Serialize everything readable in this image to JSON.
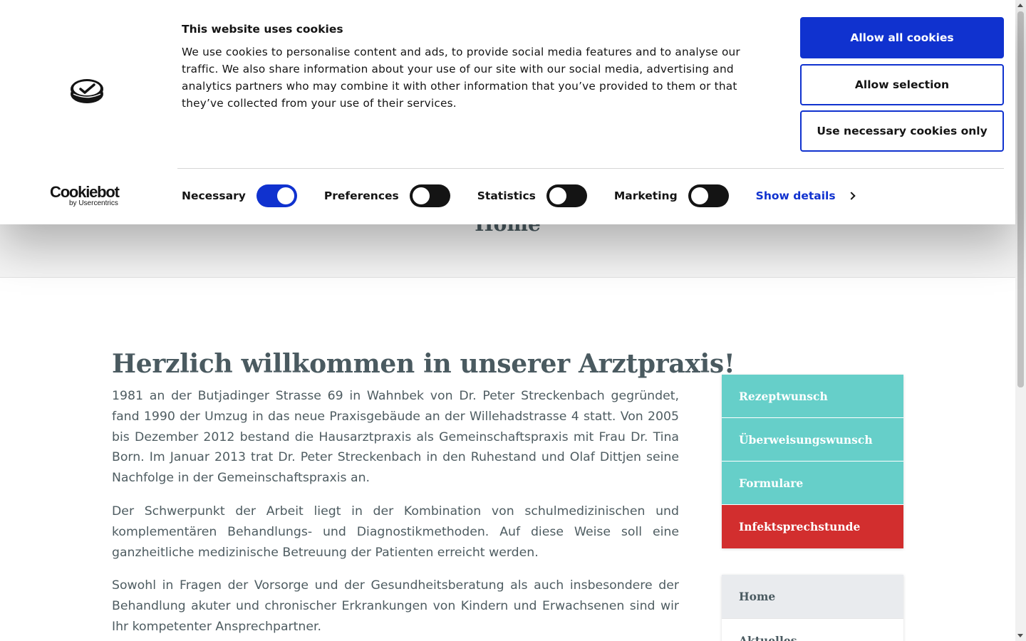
{
  "page": {
    "header_title": "Home",
    "welcome_title": "Herzlich willkommen in unserer Arztpraxis!",
    "paragraphs": [
      "1981 an der Butjadinger Strasse 69 in Wahnbek von Dr. Peter Streckenbach gegründet, fand 1990 der Umzug in das neue Praxisgebäude an der Willehadstrasse 4 statt. Von 2005 bis Dezember 2012 bestand die Hausarztpraxis als Gemeinschaftspraxis mit Frau Dr. Tina Born. Im Januar 2013 trat Dr. Peter Streckenbach in den Ruhestand und Olaf Dittjen seine Nachfolge in der Gemeinschaftspraxis an.",
      "Der Schwerpunkt der Arbeit liegt in der Kombination von schulmedizinischen und komplementären Behandlungs- und Diagnostikmethoden. Auf diese Weise soll eine ganzheitliche medizinische Betreuung der Patienten erreicht werden.",
      "Sowohl in Fragen der Vorsorge und der Gesundheitsberatung als auch insbesondere der Behandlung akuter und chronischer Erkrankungen von Kindern und Erwachsenen sind wir Ihr kompetenter Ansprechpartner."
    ]
  },
  "quick_links": [
    {
      "label": "Rezeptwunsch",
      "color": "#66cfc9"
    },
    {
      "label": "Überweisungswunsch",
      "color": "#66cfc9"
    },
    {
      "label": "Formulare",
      "color": "#66cfc9"
    },
    {
      "label": "Infektsprechstunde",
      "color": "#d22e2e"
    }
  ],
  "side_nav": [
    {
      "label": "Home",
      "active": true
    },
    {
      "label": "Aktuelles",
      "active": false
    }
  ],
  "cookie_banner": {
    "title": "This website uses cookies",
    "text": "We use cookies to personalise content and ads, to provide social media features and to analyse our traffic. We also share information about your use of our site with our social media, advertising and analytics partners who may combine it with other information that you’ve provided to them or that they’ve collected from your use of their services.",
    "buttons": {
      "allow_all": "Allow all cookies",
      "allow_selection": "Allow selection",
      "necessary_only": "Use necessary cookies only"
    },
    "brand": {
      "name": "Cookiebot",
      "sub": "by Usercentrics"
    },
    "categories": [
      {
        "label": "Necessary",
        "checked": true
      },
      {
        "label": "Preferences",
        "checked": false
      },
      {
        "label": "Statistics",
        "checked": false
      },
      {
        "label": "Marketing",
        "checked": false
      }
    ],
    "show_details": "Show details",
    "accent_color": "#1032cf"
  }
}
